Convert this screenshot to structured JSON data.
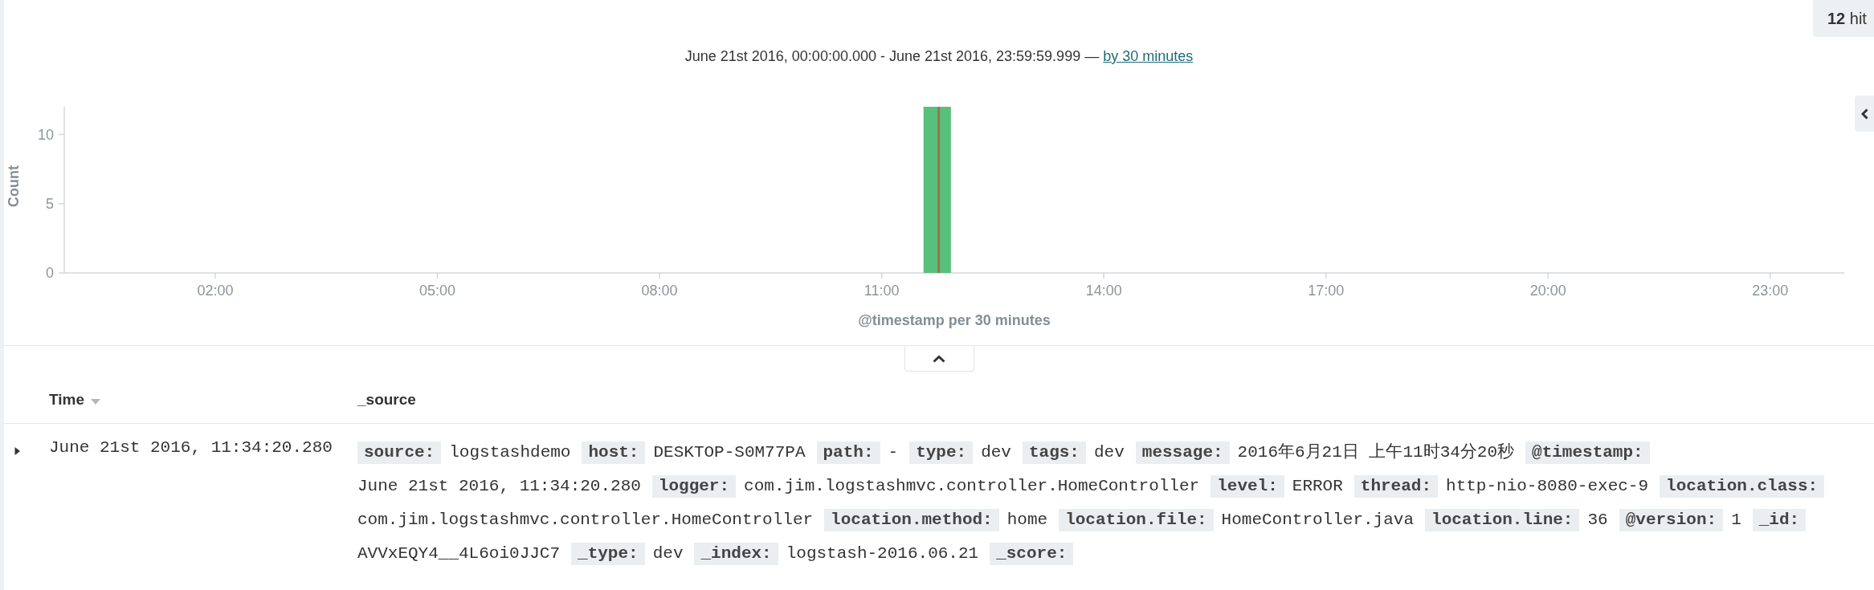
{
  "hits": {
    "text": "**12** hit"
  },
  "time_range": {
    "text": "June 21st 2016, 00:00:00.000 - June 21st 2016, 23:59:59.999 —",
    "interval_link": "by 30 minutes"
  },
  "histogram": {
    "chart_data": {
      "type": "bar",
      "xlabel": "@timestamp per 30 minutes",
      "ylabel": "Count",
      "x": [
        11.75
      ],
      "values": [
        12
      ],
      "xlim": [
        0,
        24
      ],
      "ylim": [
        0,
        12
      ],
      "xticks": [
        {
          "value": 2,
          "label": "02:00"
        },
        {
          "value": 5,
          "label": "05:00"
        },
        {
          "value": 8,
          "label": "08:00"
        },
        {
          "value": 11,
          "label": "11:00"
        },
        {
          "value": 14,
          "label": "14:00"
        },
        {
          "value": 17,
          "label": "17:00"
        },
        {
          "value": 20,
          "label": "20:00"
        },
        {
          "value": 23,
          "label": "23:00"
        }
      ],
      "yticks": [
        0,
        5,
        10
      ],
      "ref_lines": [
        {
          "axis": "x",
          "value": 11.77
        }
      ]
    }
  },
  "table": {
    "columns": [
      {
        "label": "Time",
        "sorted": true
      },
      {
        "label": "_source",
        "sorted": false
      }
    ],
    "rows": [
      {
        "expanded": false,
        "time": "June 21st 2016, 11:34:20.280",
        "fields": [
          {
            "name": "source:",
            "value": "logstashdemo"
          },
          {
            "name": "host:",
            "value": "DESKTOP-S0M77PA"
          },
          {
            "name": "path:",
            "value": "-"
          },
          {
            "name": "type:",
            "value": "dev"
          },
          {
            "name": "tags:",
            "value": "dev"
          },
          {
            "name": "message:",
            "value": "2016年6月21日 上午11时34分20秒"
          },
          {
            "name": "@timestamp:",
            "value": "June 21st 2016, 11:34:20.280"
          },
          {
            "name": "logger:",
            "value": "com.jim.logstashmvc.controller.HomeController"
          },
          {
            "name": "level:",
            "value": "ERROR"
          },
          {
            "name": "thread:",
            "value": "http-nio-8080-exec-9"
          },
          {
            "name": "location.class:",
            "value": "com.jim.logstashmvc.controller.HomeController"
          },
          {
            "name": "location.method:",
            "value": "home"
          },
          {
            "name": "location.file:",
            "value": "HomeController.java"
          },
          {
            "name": "location.line:",
            "value": "36"
          },
          {
            "name": "@version:",
            "value": "1"
          },
          {
            "name": "_id:",
            "value": "AVVxEQY4__4L6oi0JJC7"
          },
          {
            "name": "_type:",
            "value": "dev"
          },
          {
            "name": "_index:",
            "value": "logstash-2016.06.21"
          },
          {
            "name": "_score:"
          }
        ]
      }
    ]
  }
}
